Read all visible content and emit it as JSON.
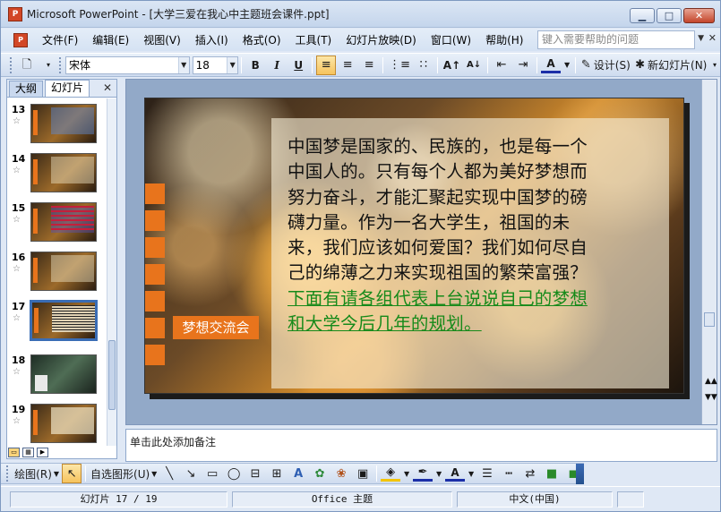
{
  "window": {
    "title": "Microsoft PowerPoint - [大学三爱在我心中主题班会课件.ppt]",
    "app_icon": "P",
    "controls": [
      "minimize",
      "maximize",
      "close"
    ]
  },
  "menubar": {
    "items": [
      "文件(F)",
      "编辑(E)",
      "视图(V)",
      "插入(I)",
      "格式(O)",
      "工具(T)",
      "幻灯片放映(D)",
      "窗口(W)",
      "帮助(H)"
    ],
    "help_placeholder": "键入需要帮助的问题"
  },
  "toolbar": {
    "font_name": "宋体",
    "font_size": "18",
    "bold": "B",
    "italic": "I",
    "underline": "U",
    "design_label": "设计(S)",
    "new_slide_label": "新幻灯片(N)"
  },
  "sidepanel": {
    "tabs": [
      "大纲",
      "幻灯片"
    ],
    "selected_tab": "幻灯片",
    "thumbnails": [
      {
        "number": "13"
      },
      {
        "number": "14"
      },
      {
        "number": "15"
      },
      {
        "number": "16"
      },
      {
        "number": "17",
        "selected": true
      },
      {
        "number": "18"
      },
      {
        "number": "19"
      }
    ]
  },
  "slide": {
    "label": "梦想交流会",
    "body_lines": [
      "中国梦是国家的、民族的，也是每一个",
      "中国人的。只有每个人都为美好梦想而",
      "努力奋斗，才能汇聚起实现中国梦的磅",
      "礴力量。作为一名大学生，祖国的未",
      "来，我们应该如何爱国？我们如何尽自",
      "己的绵薄之力来实现祖国的繁荣富强？"
    ],
    "link_lines": [
      "下面有请各组代表上台说说自己的梦想",
      "和大学今后几年的规划。"
    ],
    "accent_color": "#e8741c",
    "link_color": "#168a1a"
  },
  "notes": {
    "placeholder": "单击此处添加备注"
  },
  "drawing_toolbar": {
    "draw_label": "绘图(R)",
    "autoshapes_label": "自选图形(U)"
  },
  "statusbar": {
    "slide_position": "幻灯片 17 / 19",
    "theme": "Office 主题",
    "language": "中文(中国)"
  }
}
